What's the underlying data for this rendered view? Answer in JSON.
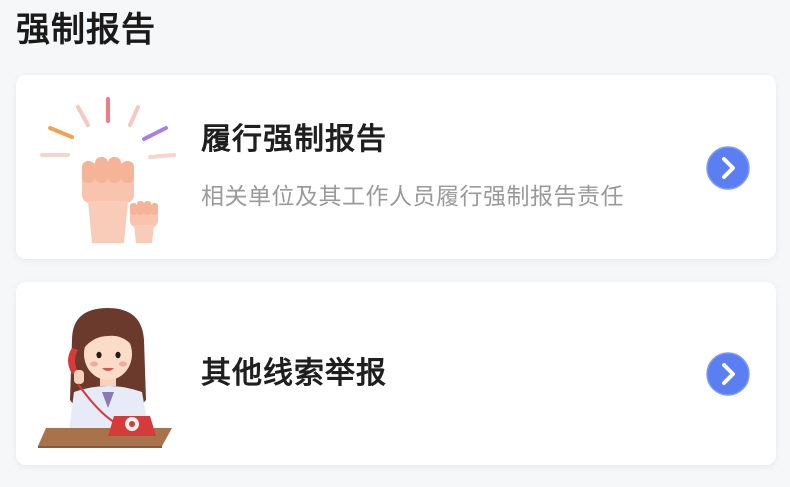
{
  "page": {
    "title": "强制报告"
  },
  "cards": [
    {
      "title": "履行强制报告",
      "subtitle": "相关单位及其工作人员履行强制报告责任",
      "illustration": "raised-fists-icon",
      "action_icon": "chevron-right-icon"
    },
    {
      "title": "其他线索举报",
      "illustration": "girl-on-phone-icon",
      "action_icon": "chevron-right-icon"
    }
  ],
  "colors": {
    "accent": "#5b7ff2",
    "title": "#1f1f1f",
    "subtitle": "#9a9a9a"
  }
}
